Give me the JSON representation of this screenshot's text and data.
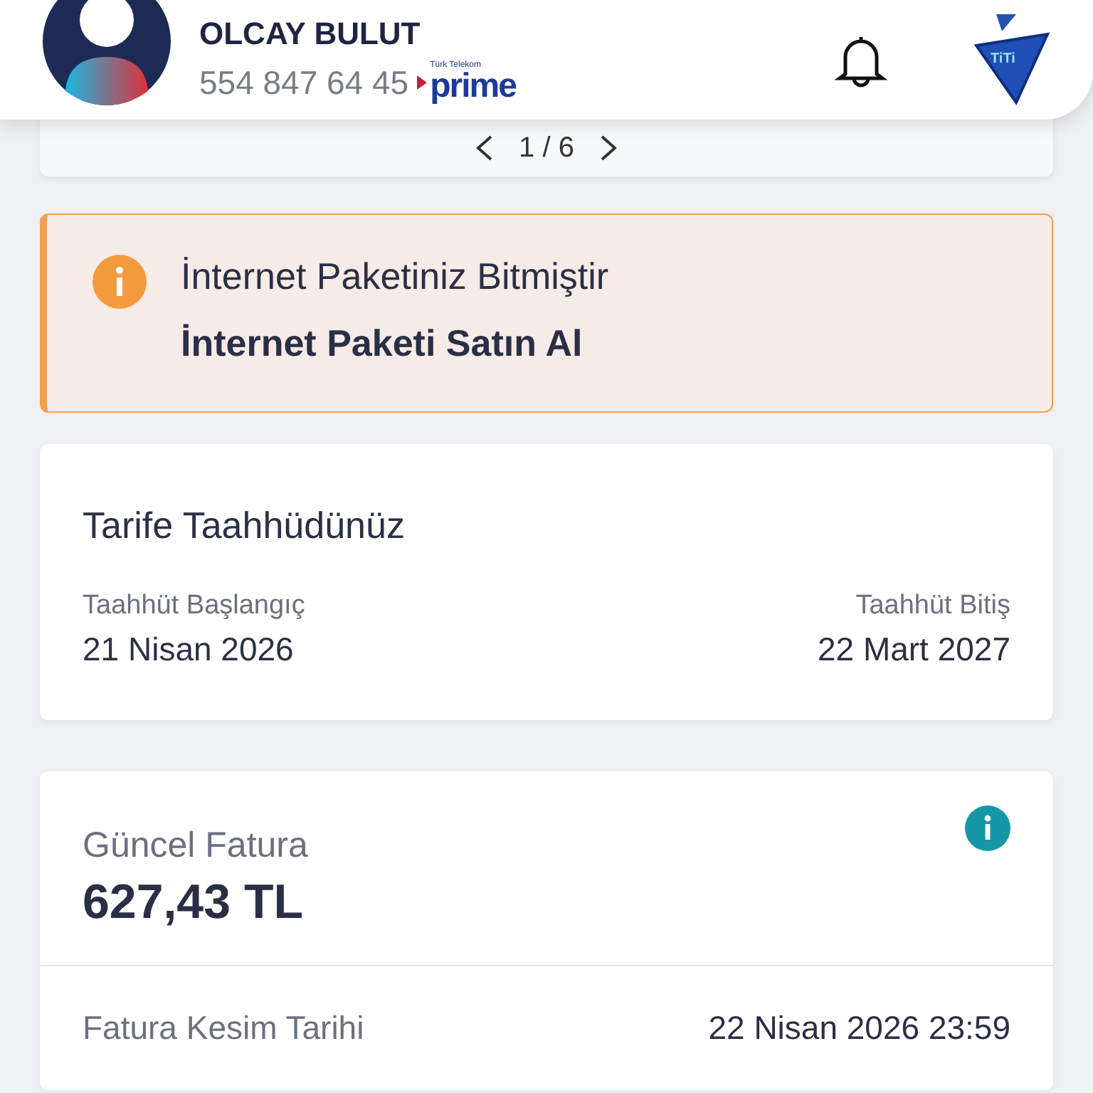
{
  "header": {
    "name": "OLCAY BULUT",
    "phone": "554 847 64 45",
    "brand_small": "Türk Telekom",
    "brand": "prime",
    "assistant": "TiTi"
  },
  "pager": {
    "text": "1 / 6"
  },
  "alert": {
    "title": "İnternet Paketiniz Bitmiştir",
    "action": "İnternet Paketi Satın Al"
  },
  "commitment": {
    "title": "Tarife Taahhüdünüz",
    "start_label": "Taahhüt Başlangıç",
    "start": "21 Nisan 2026",
    "end_label": "Taahhüt Bitiş",
    "end": "22 Mart 2027"
  },
  "bill": {
    "title": "Güncel Fatura",
    "amount": "627,43 TL",
    "rows": [
      {
        "label": "Fatura Kesim Tarihi",
        "value": "22 Nisan 2026 23:59"
      }
    ]
  }
}
